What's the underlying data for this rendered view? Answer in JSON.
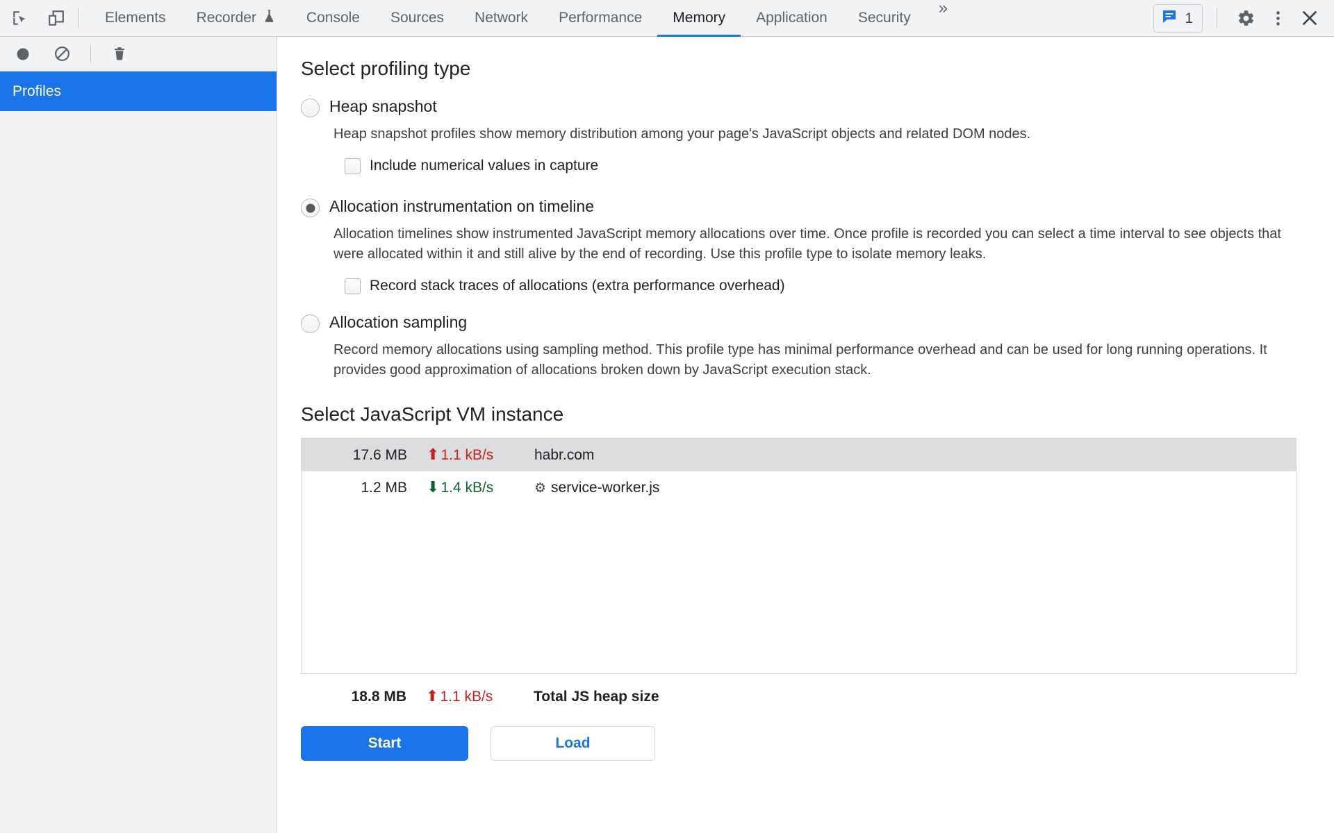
{
  "toolbar": {
    "left_icons": [
      {
        "name": "inspect-element-icon",
        "label": "Inspect element"
      },
      {
        "name": "device-toolbar-icon",
        "label": "Toggle device toolbar"
      }
    ],
    "tabs": [
      {
        "label": "Elements",
        "active": false,
        "icon": ""
      },
      {
        "label": "Recorder",
        "active": false,
        "icon": "flask-icon"
      },
      {
        "label": "Console",
        "active": false,
        "icon": ""
      },
      {
        "label": "Sources",
        "active": false,
        "icon": ""
      },
      {
        "label": "Network",
        "active": false,
        "icon": ""
      },
      {
        "label": "Performance",
        "active": false,
        "icon": ""
      },
      {
        "label": "Memory",
        "active": true,
        "icon": ""
      },
      {
        "label": "Application",
        "active": false,
        "icon": ""
      },
      {
        "label": "Security",
        "active": false,
        "icon": ""
      }
    ],
    "more_tabs_label": "»",
    "message_count": "1",
    "right_icons": [
      {
        "name": "settings-gear-icon",
        "label": "Settings"
      },
      {
        "name": "more-options-icon",
        "label": "Customize and control DevTools"
      },
      {
        "name": "close-devtools-icon",
        "label": "Close DevTools"
      }
    ]
  },
  "left_panel": {
    "toolbar_icons": [
      {
        "name": "record-button",
        "label": "Start/stop recording"
      },
      {
        "name": "clear-all-profiles-icon",
        "label": "Clear all profiles"
      },
      {
        "name": "delete-profile-icon",
        "label": "Delete profile"
      }
    ],
    "selected_item": "Profiles"
  },
  "main": {
    "profiling_type_title": "Select profiling type",
    "options": [
      {
        "id": "heap-snapshot",
        "label": "Heap snapshot",
        "selected": false,
        "description": "Heap snapshot profiles show memory distribution among your page's JavaScript objects and related DOM nodes.",
        "checkbox": {
          "label": "Include numerical values in capture",
          "checked": false
        }
      },
      {
        "id": "allocation-instrumentation",
        "label": "Allocation instrumentation on timeline",
        "selected": true,
        "description": "Allocation timelines show instrumented JavaScript memory allocations over time. Once profile is recorded you can select a time interval to see objects that were allocated within it and still alive by the end of recording. Use this profile type to isolate memory leaks.",
        "checkbox": {
          "label": "Record stack traces of allocations (extra performance overhead)",
          "checked": false
        }
      },
      {
        "id": "allocation-sampling",
        "label": "Allocation sampling",
        "selected": false,
        "description": "Record memory allocations using sampling method. This profile type has minimal performance overhead and can be used for long running operations. It provides good approximation of allocations broken down by JavaScript execution stack.",
        "checkbox": null
      }
    ],
    "vm_instance_title": "Select JavaScript VM instance",
    "vm_rows": [
      {
        "size": "17.6 MB",
        "rate": "1.1 kB/s",
        "trend": "up",
        "name": "habr.com",
        "icon": "",
        "selected": true
      },
      {
        "size": "1.2 MB",
        "rate": "1.4 kB/s",
        "trend": "down",
        "name": "service-worker.js",
        "icon": "gear-icon",
        "selected": false
      }
    ],
    "total": {
      "size": "18.8 MB",
      "rate": "1.1 kB/s",
      "trend": "up",
      "label": "Total JS heap size"
    },
    "start_button": "Start",
    "load_button": "Load"
  },
  "colors": {
    "accent_blue": "#1a73e8",
    "increase_red": "#c5221f",
    "decrease_green": "#0d652d",
    "toolbar_bg": "#f1f3f4",
    "selected_row_bg": "#dcdddf"
  }
}
